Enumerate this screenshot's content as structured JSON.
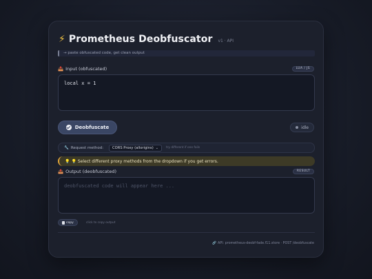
{
  "app": {
    "title": "Prometheus Deobfuscator",
    "version": "v1 · API",
    "hint": "→ paste obfuscated code, get clean output"
  },
  "input": {
    "label": "Input (obfuscated)",
    "badge": "LUA / JS",
    "value": "local x = 1"
  },
  "actions": {
    "deobfuscate_label": "Deobfuscate",
    "status": "idle"
  },
  "method": {
    "label": "Request method:",
    "selected": "CORS Proxy (allorigins)",
    "note": "try different if one fails"
  },
  "warning": {
    "text": "💡 Select different proxy methods from the dropdown if you get errors."
  },
  "output": {
    "label": "Output (deobfuscated)",
    "badge": "RESULT",
    "placeholder": "deobfuscated code will appear here ..."
  },
  "copy": {
    "label": "copy",
    "note": "click to copy output"
  },
  "footer": {
    "text": "API: prometheus-deobf-fade.f11.store · POST /deobfuscate"
  },
  "icons": {
    "bolt": "lightning-icon",
    "inbox": "inbox-icon",
    "outbox": "outbox-icon",
    "wrench": "wrench-icon",
    "bulb": "lightbulb-icon",
    "clipboard": "clipboard-icon",
    "link": "link-icon"
  },
  "colors": {
    "accent": "#f5c542",
    "button": "#3a4664",
    "warning_border": "#e0a43a"
  }
}
